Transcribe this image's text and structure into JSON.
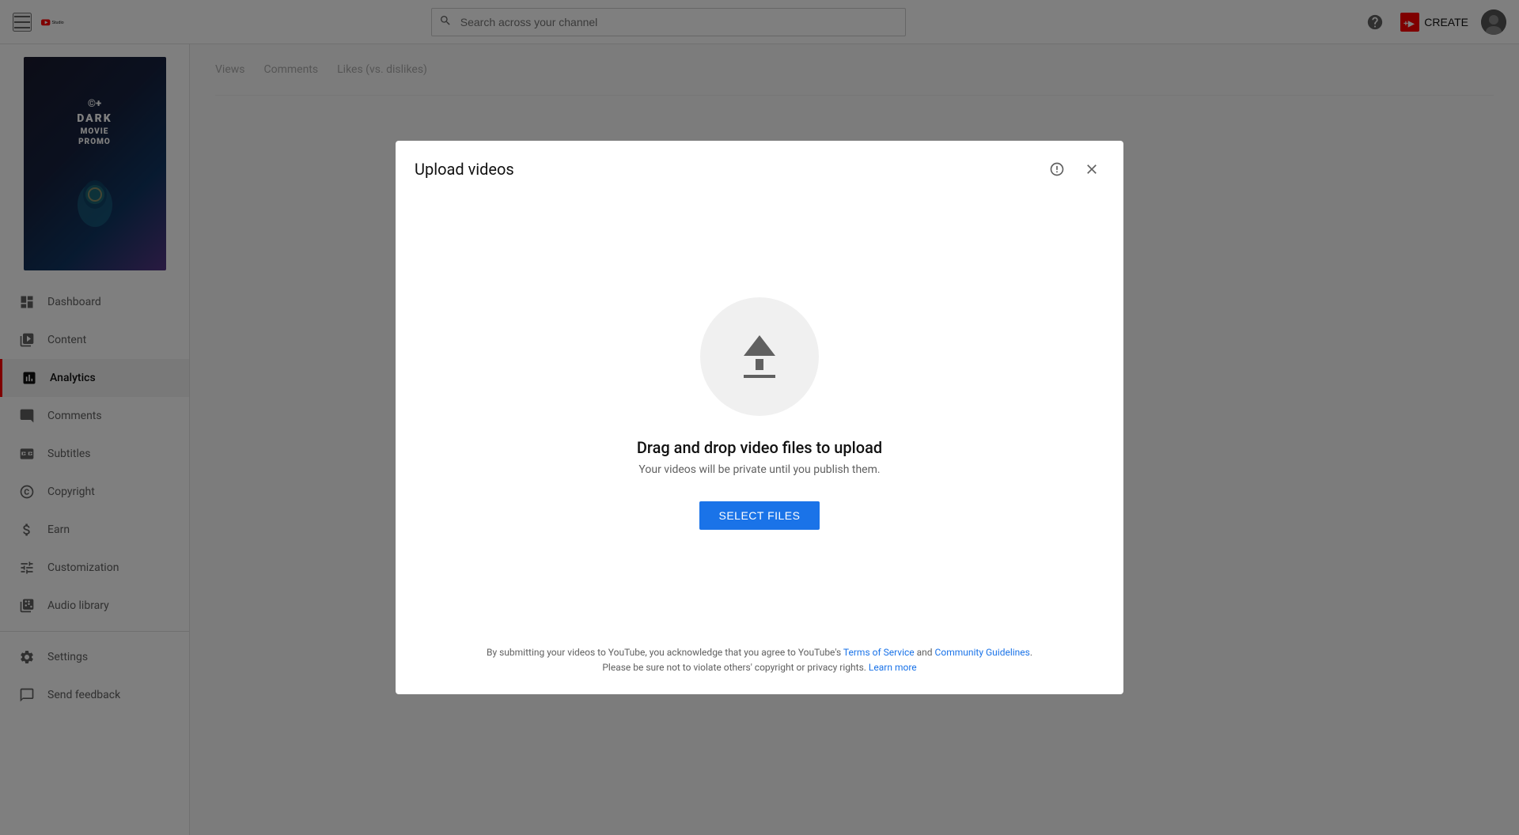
{
  "app": {
    "name": "YouTube Studio",
    "logo_text": "Studio"
  },
  "header": {
    "menu_icon": "hamburger-icon",
    "search_placeholder": "Search across your channel",
    "help_icon": "help-icon",
    "create_label": "CREATE",
    "create_icon": "create-video-icon",
    "avatar_icon": "user-avatar"
  },
  "sidebar": {
    "channel_name": "DARK MOVIE PROMO",
    "channel_subtitle": "©+",
    "nav_items": [
      {
        "id": "dashboard",
        "label": "Dashboard",
        "icon": "dashboard-icon"
      },
      {
        "id": "content",
        "label": "Content",
        "icon": "content-icon"
      },
      {
        "id": "analytics",
        "label": "Analytics",
        "icon": "analytics-icon",
        "active": true
      },
      {
        "id": "comments",
        "label": "Comments",
        "icon": "comments-icon"
      },
      {
        "id": "subtitles",
        "label": "Subtitles",
        "icon": "subtitles-icon"
      },
      {
        "id": "copyright",
        "label": "Copyright",
        "icon": "copyright-icon"
      },
      {
        "id": "earn",
        "label": "Earn",
        "icon": "earn-icon"
      },
      {
        "id": "customization",
        "label": "Customization",
        "icon": "customization-icon"
      },
      {
        "id": "audio-library",
        "label": "Audio library",
        "icon": "audio-library-icon"
      }
    ],
    "bottom_items": [
      {
        "id": "settings",
        "label": "Settings",
        "icon": "settings-icon"
      },
      {
        "id": "send-feedback",
        "label": "Send feedback",
        "icon": "feedback-icon"
      }
    ]
  },
  "main": {
    "analytics_tabs": [
      {
        "label": "Views",
        "active": false
      },
      {
        "label": "Comments",
        "active": false
      },
      {
        "label": "Likes (vs. dislikes)",
        "active": false
      }
    ]
  },
  "modal": {
    "title": "Upload videos",
    "feedback_icon": "feedback-icon",
    "close_icon": "close-icon",
    "upload_icon": "upload-icon",
    "drag_drop_text": "Drag and drop video files to upload",
    "drag_drop_subtext": "Your videos will be private until you publish them.",
    "select_files_label": "SELECT FILES",
    "footer": {
      "main_text": "By submitting your videos to YouTube, you acknowledge that you agree to YouTube's",
      "terms_link": "Terms of Service",
      "and_text": "and",
      "guidelines_link": "Community Guidelines",
      "period": ".",
      "copyright_text": "Please be sure not to violate others' copyright or privacy rights.",
      "learn_more_link": "Learn more"
    }
  }
}
